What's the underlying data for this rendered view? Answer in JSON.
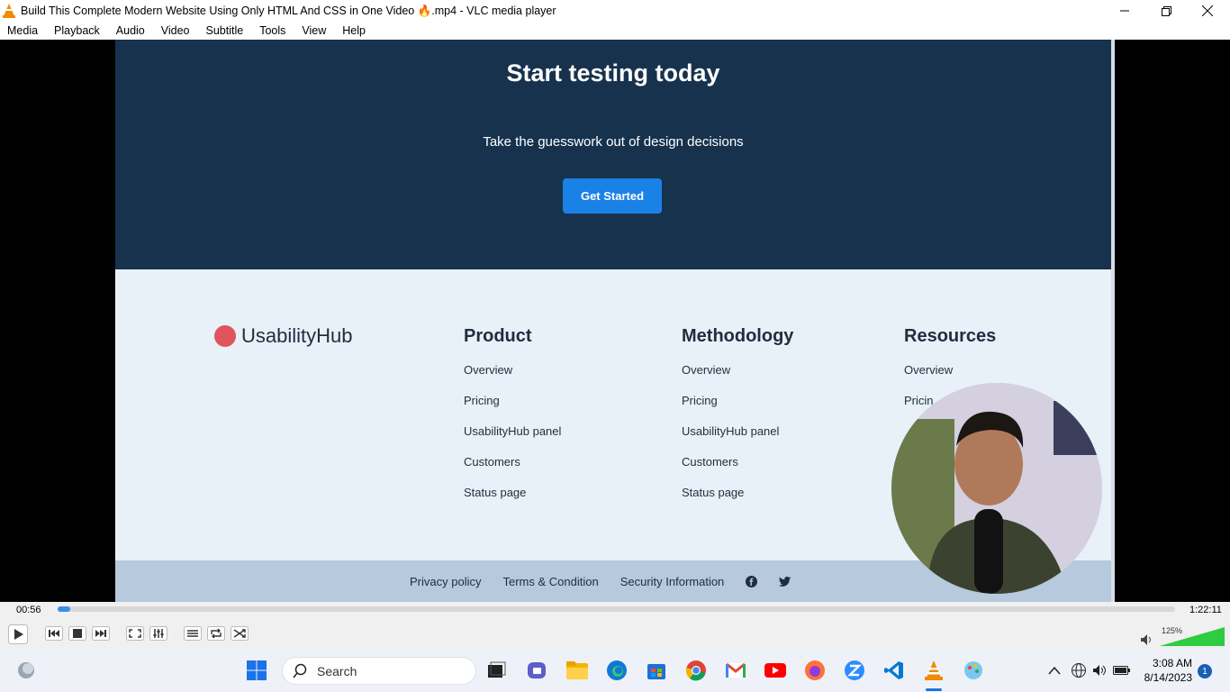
{
  "window": {
    "title": "Build This Complete Modern Website Using Only HTML And CSS in One Video 🔥.mp4 - VLC media player",
    "minimize_icon": "minimize-icon",
    "maximize_icon": "restore-icon",
    "close_icon": "close-icon"
  },
  "menu": [
    "Media",
    "Playback",
    "Audio",
    "Video",
    "Subtitle",
    "Tools",
    "View",
    "Help"
  ],
  "video": {
    "hero_title": "Start testing today",
    "hero_subtitle": "Take the guesswork out of design decisions",
    "cta_label": "Get Started",
    "logo_text": "UsabilityHub",
    "columns": [
      {
        "heading": "Product",
        "links": [
          "Overview",
          "Pricing",
          "UsabilityHub panel",
          "Customers",
          "Status page"
        ]
      },
      {
        "heading": "Methodology",
        "links": [
          "Overview",
          "Pricing",
          "UsabilityHub panel",
          "Customers",
          "Status page"
        ]
      },
      {
        "heading": "Resources",
        "links": [
          "Overview",
          "Pricin"
        ]
      }
    ],
    "footer_links": [
      "Privacy policy",
      "Terms & Condition",
      "Security Information"
    ],
    "social_icons": [
      "facebook-icon",
      "twitter-icon"
    ]
  },
  "player": {
    "elapsed": "00:56",
    "total": "1:22:11",
    "progress": 0.011,
    "volume_label": "125%",
    "volume_level": 1.0
  },
  "taskbar": {
    "search_placeholder": "Search",
    "time": "3:08 AM",
    "date": "8/14/2023",
    "notification_count": "1"
  },
  "colors": {
    "hero_bg": "#17324d",
    "cta_bg": "#1a82e6",
    "footer_bg": "#e9f1f8",
    "footer_bar": "#b6c9dd",
    "seek_fill": "#3a8ee6",
    "volume_fill": "#2ecc40"
  }
}
